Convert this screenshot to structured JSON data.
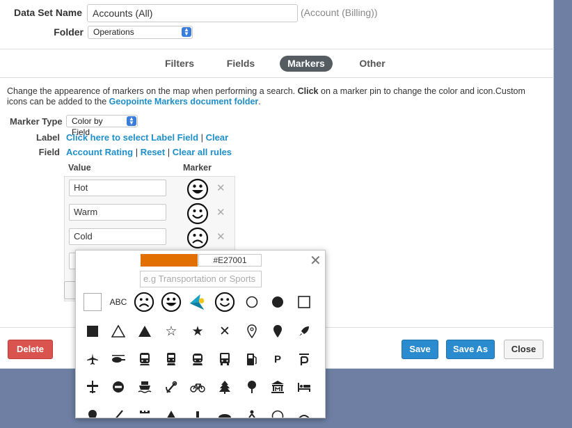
{
  "form": {
    "dataset_label": "Data Set Name",
    "dataset_value": "Accounts (All)",
    "dataset_hint": "(Account (Billing))",
    "folder_label": "Folder",
    "folder_value": "Operations"
  },
  "tabs": [
    {
      "label": "Filters"
    },
    {
      "label": "Fields"
    },
    {
      "label": "Markers"
    },
    {
      "label": "Other"
    }
  ],
  "description": {
    "text1": "Change the appearence of markers on the map when performing a search.",
    "bold": "Click",
    "text2": "on a marker pin to change the color and icon.Custom icons can be added to the",
    "link": "Geopointe Markers document folder",
    "end": "."
  },
  "marker_type": {
    "label": "Marker Type",
    "value": "Color by Field"
  },
  "label_row": {
    "label": "Label",
    "link1": "Click here to select Label Field",
    "link2": "Clear"
  },
  "field_row": {
    "label": "Field",
    "link1": "Account Rating",
    "link2": "Reset",
    "link3": "Clear all rules"
  },
  "rules": {
    "value_header": "Value",
    "marker_header": "Marker",
    "items": [
      {
        "value": "Hot",
        "marker": "big-smile-icon"
      },
      {
        "value": "Warm",
        "marker": "smile-icon"
      },
      {
        "value": "Cold",
        "marker": "frown-icon"
      }
    ]
  },
  "buttons": {
    "delete": "Delete",
    "save": "Save",
    "save_as": "Save As",
    "close": "Close"
  },
  "picker": {
    "color": "#E27001",
    "search_placeholder": "e.g Transportation or Sports",
    "rows": [
      [
        "blank-square-icon",
        "abc-text-icon",
        "frown-icon",
        "big-smile-icon",
        "geopointe-logo-icon",
        "smile-icon",
        "circle-outline-icon",
        "circle-filled-icon",
        "square-outline-icon"
      ],
      [
        "square-filled-icon",
        "triangle-outline-icon",
        "triangle-filled-icon",
        "star-outline-icon",
        "star-filled-icon",
        "x-icon",
        "pin-outline-icon",
        "pin-filled-icon",
        "rocket-icon"
      ],
      [
        "airplane-icon",
        "helicopter-icon",
        "train-icon",
        "subway-icon",
        "tram-icon",
        "bus-icon",
        "fuel-icon",
        "parking-icon",
        "parking-alt-icon"
      ],
      [
        "airfield-icon",
        "no-entry-icon",
        "ferry-icon",
        "harbor-icon",
        "bicycle-icon",
        "conifer-tree-icon",
        "tree-icon",
        "town-hall-icon",
        "lodging-icon"
      ]
    ],
    "abc_text": "ABC",
    "parking_text": "P"
  },
  "colors": {
    "accent": "#1f8fc9",
    "orange": "#E27001",
    "delete": "#d9534f"
  }
}
